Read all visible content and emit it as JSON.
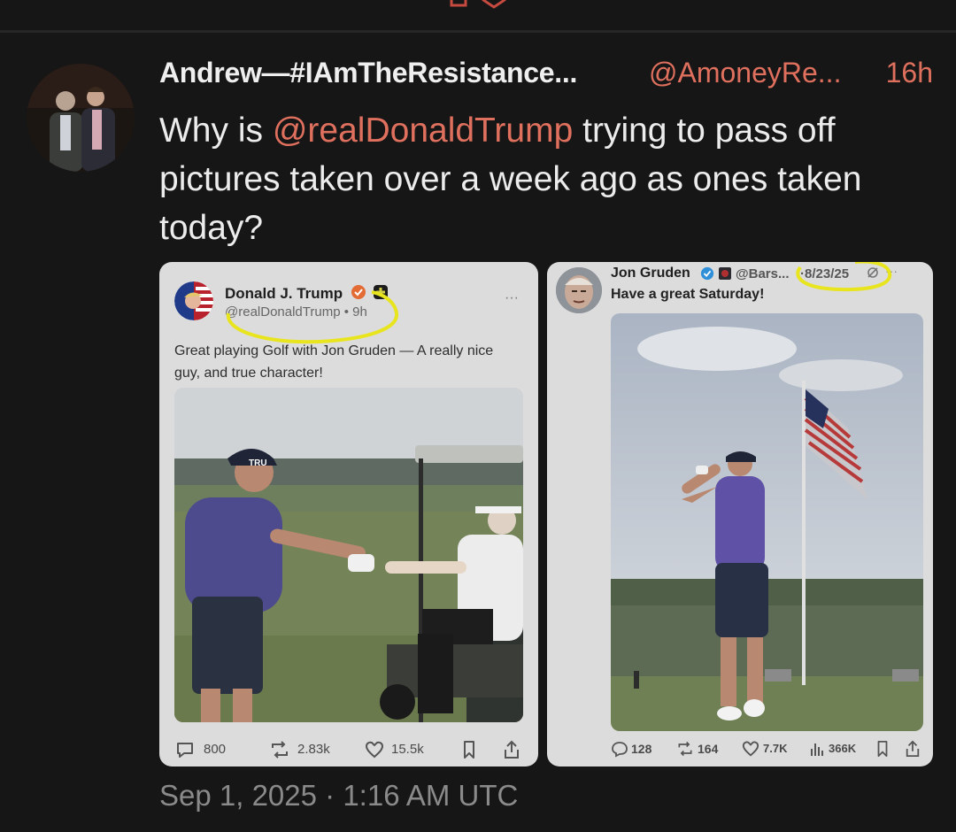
{
  "tweet": {
    "display_name": "Andrew—#IAmTheResistance...",
    "handle": "@AmoneyRe...",
    "time": "16h",
    "text_before": "Why is ",
    "mention": "@realDonaldTrump",
    "text_after": " trying to pass off pictures taken over a week ago as ones taken today?",
    "timestamp": "Sep 1, 2025 · 1:16 AM UTC"
  },
  "left_post": {
    "author": "Donald J. Trump",
    "handle_time": "@realDonaldTrump • 9h",
    "more": "···",
    "text": "Great playing Golf with Jon Gruden — A really nice guy, and true character!",
    "cap_text": "TRU",
    "stats": {
      "replies": "800",
      "reposts": "2.83k",
      "likes": "15.5k"
    }
  },
  "right_post": {
    "author": "Jon Gruden",
    "handle": "@Bars...",
    "date": "·8/23/25",
    "more": "···",
    "text": "Have a great Saturday!",
    "stats": {
      "replies": "128",
      "reposts": "164",
      "likes": "7.7K",
      "views": "366K"
    }
  },
  "colors": {
    "background": "#161616",
    "mention": "#e0705e",
    "highlight": "#e8e41e",
    "verified": "#2f8fd9"
  },
  "icons": {
    "verified": "verified-badge-icon",
    "reply": "reply-icon",
    "repost": "repost-icon",
    "like": "heart-icon",
    "views": "bar-chart-icon",
    "bookmark": "bookmark-icon",
    "share": "share-icon"
  }
}
